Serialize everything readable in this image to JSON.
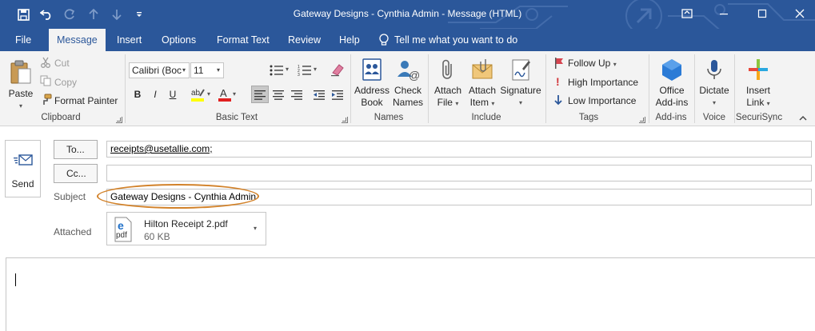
{
  "window": {
    "title": "Gateway Designs - Cynthia Admin  -  Message (HTML)"
  },
  "tabs": [
    "File",
    "Message",
    "Insert",
    "Options",
    "Format Text",
    "Review",
    "Help"
  ],
  "tell_me": "Tell me what you want to do",
  "clipboard": {
    "paste": "Paste",
    "cut": "Cut",
    "copy": "Copy",
    "format_painter": "Format Painter",
    "group": "Clipboard"
  },
  "basic_text": {
    "font_name": "Calibri (Boc",
    "font_size": "11",
    "group": "Basic Text",
    "bold": "B",
    "italic": "I",
    "underline": "U"
  },
  "names": {
    "address_book_1": "Address",
    "address_book_2": "Book",
    "check_names_1": "Check",
    "check_names_2": "Names",
    "group": "Names"
  },
  "include": {
    "attach_file_1": "Attach",
    "attach_file_2": "File",
    "attach_item_1": "Attach",
    "attach_item_2": "Item",
    "signature_1": "Signature",
    "group": "Include"
  },
  "tags": {
    "follow_up": "Follow Up",
    "high_importance": "High Importance",
    "low_importance": "Low Importance",
    "group": "Tags"
  },
  "addins": {
    "office_addins_1": "Office",
    "office_addins_2": "Add-ins",
    "group": "Add-ins"
  },
  "voice": {
    "dictate": "Dictate",
    "group": "Voice"
  },
  "securisync": {
    "insert_link_1": "Insert",
    "insert_link_2": "Link",
    "group": "SecuriSync"
  },
  "compose": {
    "send": "Send",
    "to_button": "To...",
    "cc_button": "Cc...",
    "to_value": "receipts@usetallie.com;",
    "cc_value": "",
    "subject_label": "Subject",
    "subject_value": "Gateway Designs - Cynthia Admin",
    "attached_label": "Attached",
    "attachment_name": "Hilton Receipt 2.pdf",
    "attachment_size": "60 KB",
    "attachment_type": "pdf",
    "body": ""
  },
  "colors": {
    "accent": "#2b579a",
    "ribbon_bg": "#f3f3f3",
    "highlight": "#d2822a"
  }
}
